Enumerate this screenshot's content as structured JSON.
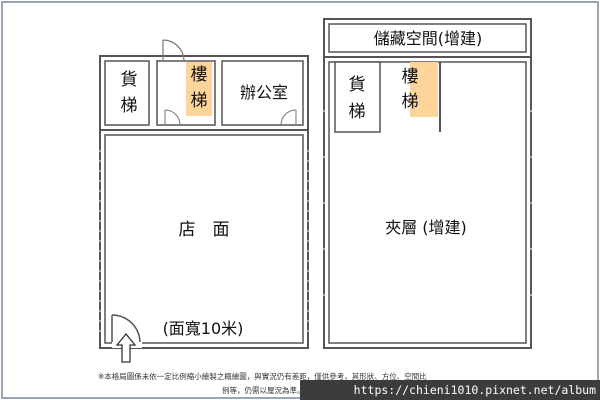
{
  "plan_left": {
    "rooms": {
      "elevator": "貨\n梯",
      "stairs": "樓\n梯",
      "office": "辦公室",
      "shop": "店　面",
      "frontage": "(面寬10米)"
    }
  },
  "plan_right": {
    "rooms": {
      "storage": "儲藏空間(增建)",
      "elevator": "貨\n梯",
      "stairs": "樓\n梯",
      "mezzanine": "夾層 (增建)"
    }
  },
  "footnote": {
    "line1": "※本格局圖係未依一定比例縮小繪製之概繪圖，與實況仍有差距，僅供參考，其形狀、方位、空間比",
    "line2": "例等，仍需以屋況為準。"
  },
  "watermark": "https://chieni1010.pixnet.net/album",
  "colors": {
    "stairs_fill": "#fdd59a",
    "wall": "#555555",
    "frame": "#9aa6b4"
  }
}
